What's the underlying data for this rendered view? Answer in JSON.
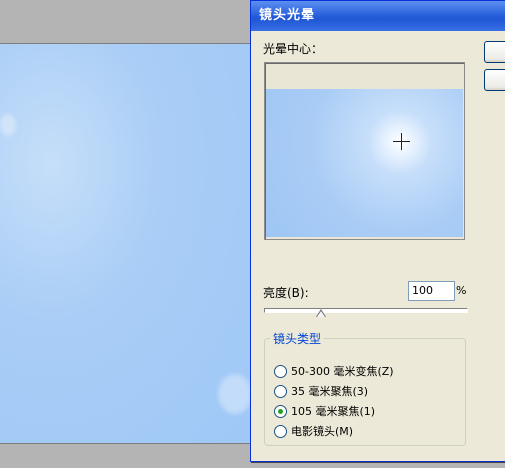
{
  "dialog": {
    "title": "镜头光晕",
    "preview_label": "光晕中心：",
    "brightness_label": "亮度(B):",
    "brightness_value": "100",
    "brightness_unit": "%",
    "brightness_level_percent": 28,
    "lens_group_title": "镜头类型",
    "lens_options": [
      {
        "label": "50-300 毫米变焦(Z)",
        "checked": false
      },
      {
        "label": "35 毫米聚焦(3)",
        "checked": false
      },
      {
        "label": "105 毫米聚焦(1)",
        "checked": true
      },
      {
        "label": "电影镜头(M)",
        "checked": false
      }
    ]
  },
  "colors": {
    "titlebar": "#2a63dd",
    "dialog_bg": "#ece9d8",
    "group_title": "#0046d5",
    "radio_check": "#21a121"
  }
}
